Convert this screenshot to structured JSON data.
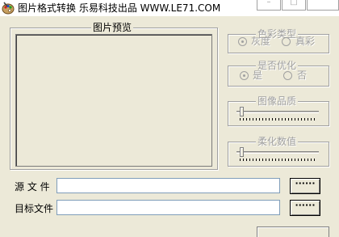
{
  "window": {
    "title": "图片格式转换   乐易科技出品 WWW.LE71.COM",
    "icon": "palette-icon",
    "controls": {
      "minimize": "–",
      "maximize": "□",
      "close": ""
    }
  },
  "preview": {
    "legend": "图片预览"
  },
  "color_type": {
    "legend": "色彩类型",
    "options": [
      {
        "label": "灰度",
        "selected": true
      },
      {
        "label": "真彩",
        "selected": false
      }
    ]
  },
  "optimize": {
    "legend": "是否优化",
    "options": [
      {
        "label": "是",
        "selected": true
      },
      {
        "label": "否",
        "selected": false
      }
    ]
  },
  "quality": {
    "legend": "图像品质",
    "value": 0
  },
  "softening": {
    "legend": "柔化数值",
    "value": 0
  },
  "source": {
    "label": "源 文 件",
    "value": "",
    "browse_label": "······"
  },
  "target": {
    "label": "目标文件",
    "value": "",
    "browse_label": "······"
  }
}
